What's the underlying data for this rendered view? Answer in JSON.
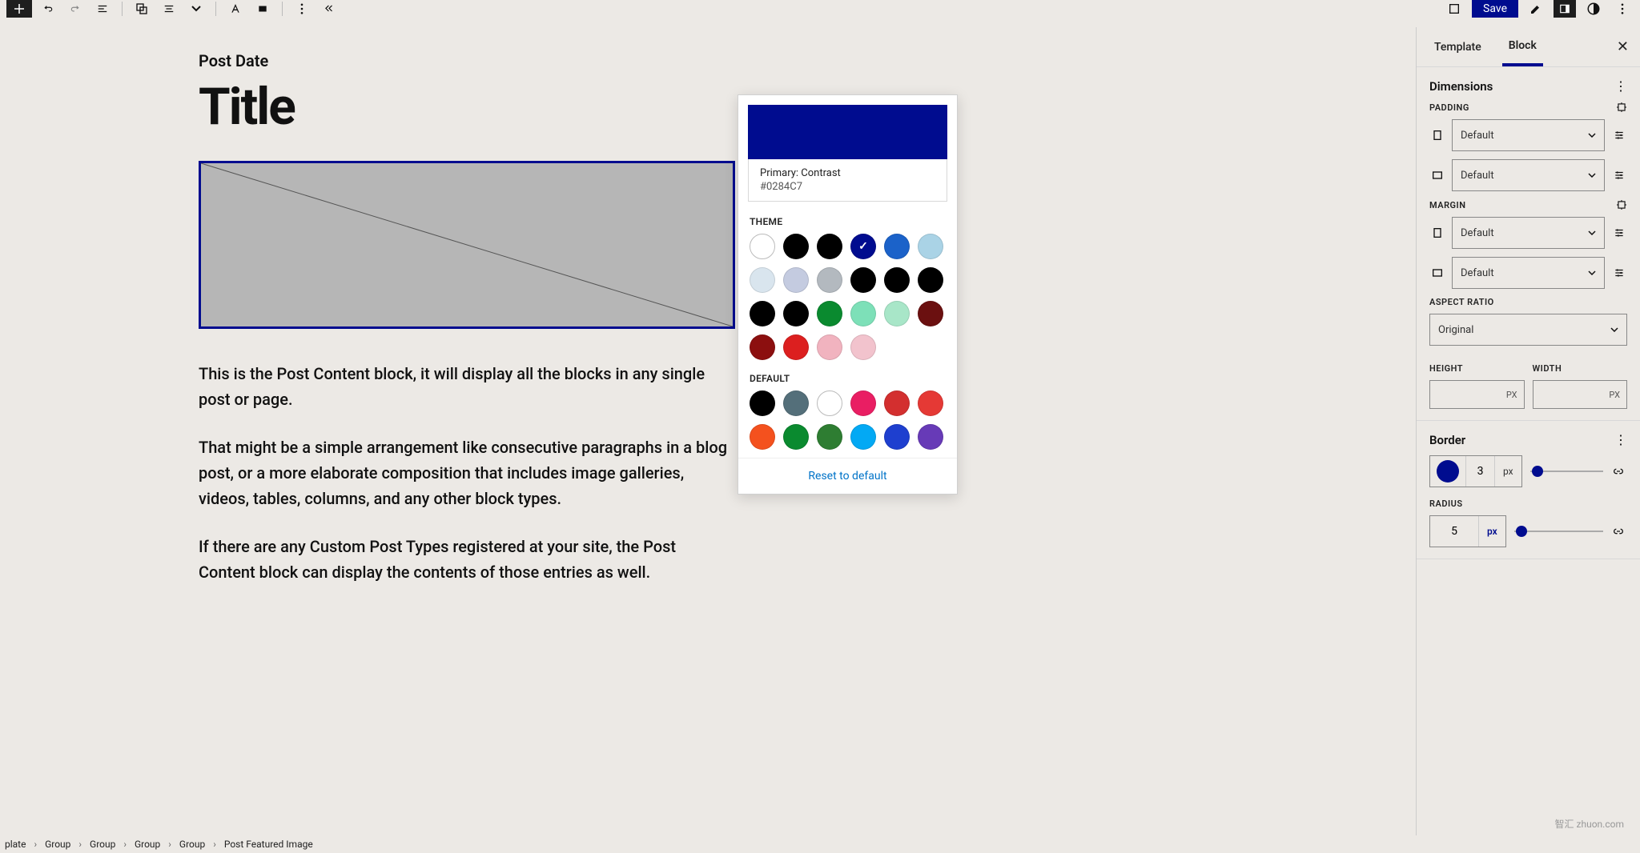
{
  "toolbar": {
    "save_label": "Save"
  },
  "content": {
    "date_label": "Post Date",
    "title": "Title",
    "p1": "This is the Post Content block, it will display all the blocks in any single post or page.",
    "p2": "That might be a simple arrangement like consecutive paragraphs in a blog post, or a more elaborate composition that includes image galleries, videos, tables, columns, and any other block types.",
    "p3": "If there are any Custom Post Types registered at your site, the Post Content block can display the contents of those entries as well."
  },
  "color_picker": {
    "name": "Primary: Contrast",
    "hex": "#0284C7",
    "theme_label": "THEME",
    "default_label": "DEFAULT",
    "reset": "Reset to default",
    "theme_colors": [
      "#ffffff",
      "#000000",
      "#000000",
      "#000c8f",
      "#1b62c9",
      "#aad3e6",
      "#d9e5ee",
      "#c4cbe0",
      "#b3b9bf",
      "#000000",
      "#000000",
      "#000000",
      "#000000",
      "#000000",
      "#0a8a2f",
      "#7de0b8",
      "#a8e6c8",
      "#6b1010",
      "#8c0f0f",
      "#dc1f1f",
      "#f1b3bf",
      "#f2c3cd"
    ],
    "theme_selected_index": 3,
    "default_colors": [
      "#000000",
      "#546f7a",
      "#ffffff",
      "#e91e63",
      "#d32f2f",
      "#e53935",
      "#f4511e",
      "#0a8a2f",
      "#2e7d32",
      "#03a9f4",
      "#1e3fcf",
      "#673ab7"
    ]
  },
  "sidebar": {
    "tabs": {
      "template": "Template",
      "block": "Block"
    },
    "dimensions": {
      "title": "Dimensions",
      "padding_label": "PADDING",
      "margin_label": "MARGIN",
      "padding1": "Default",
      "padding2": "Default",
      "margin1": "Default",
      "margin2": "Default",
      "aspect_label": "ASPECT RATIO",
      "aspect_value": "Original",
      "height_label": "HEIGHT",
      "width_label": "WIDTH",
      "px": "PX"
    },
    "border": {
      "title": "Border",
      "value": "3",
      "unit": "px",
      "radius_label": "RADIUS",
      "radius_value": "5",
      "radius_unit": "px"
    }
  },
  "breadcrumb": [
    "plate",
    "Group",
    "Group",
    "Group",
    "Group",
    "Post Featured Image"
  ],
  "watermark": "智汇 zhuon.com"
}
